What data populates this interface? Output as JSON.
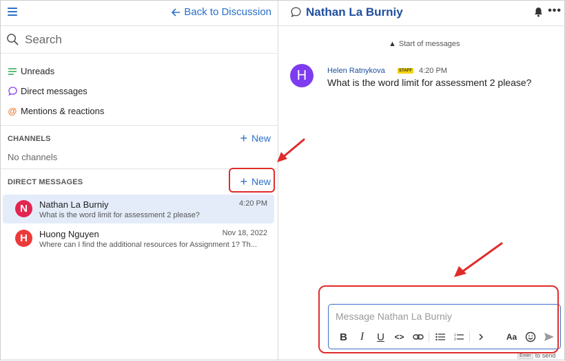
{
  "left": {
    "back_label": "Back to Discussion",
    "search_placeholder": "Search",
    "nav": [
      {
        "label": "Unreads",
        "icon": "lines-icon"
      },
      {
        "label": "Direct messages",
        "icon": "chat-bubble-icon"
      },
      {
        "label": "Mentions & reactions",
        "icon": "at-icon"
      }
    ],
    "channels": {
      "title": "CHANNELS",
      "new_label": "New",
      "empty_text": "No channels"
    },
    "direct_messages": {
      "title": "DIRECT MESSAGES",
      "new_label": "New",
      "items": [
        {
          "initial": "N",
          "name": "Nathan La Burniy",
          "time": "4:20 PM",
          "preview": "What is the word limit for assessment 2 please?",
          "color": "#e3264f",
          "active": true
        },
        {
          "initial": "H",
          "name": "Huong Nguyen",
          "time": "Nov 18, 2022",
          "preview": "Where can I find the additional resources for Assignment 1? Th...",
          "color": "#ec3a3a",
          "active": false
        }
      ]
    }
  },
  "right": {
    "title": "Nathan La Burniy",
    "more_label": "•••",
    "start_label": "Start of messages",
    "message": {
      "initial": "H",
      "author": "Helen Ratnykova",
      "badge": "STAFF",
      "time": "4:20 PM",
      "text": "What is the word limit for assessment 2 please?"
    },
    "composer": {
      "placeholder": "Message Nathan La Burniy",
      "toolbar": {
        "bold": "B",
        "italic": "I",
        "underline": "U",
        "code": "<>",
        "font": "Aa"
      }
    },
    "enter_hint": {
      "key": "Enter",
      "label": "to send"
    }
  },
  "colors": {
    "accent": "#2a6fc9",
    "title": "#1f4fa0",
    "annotation": "#e02b2b",
    "selected_row": "#e4ecfa"
  }
}
